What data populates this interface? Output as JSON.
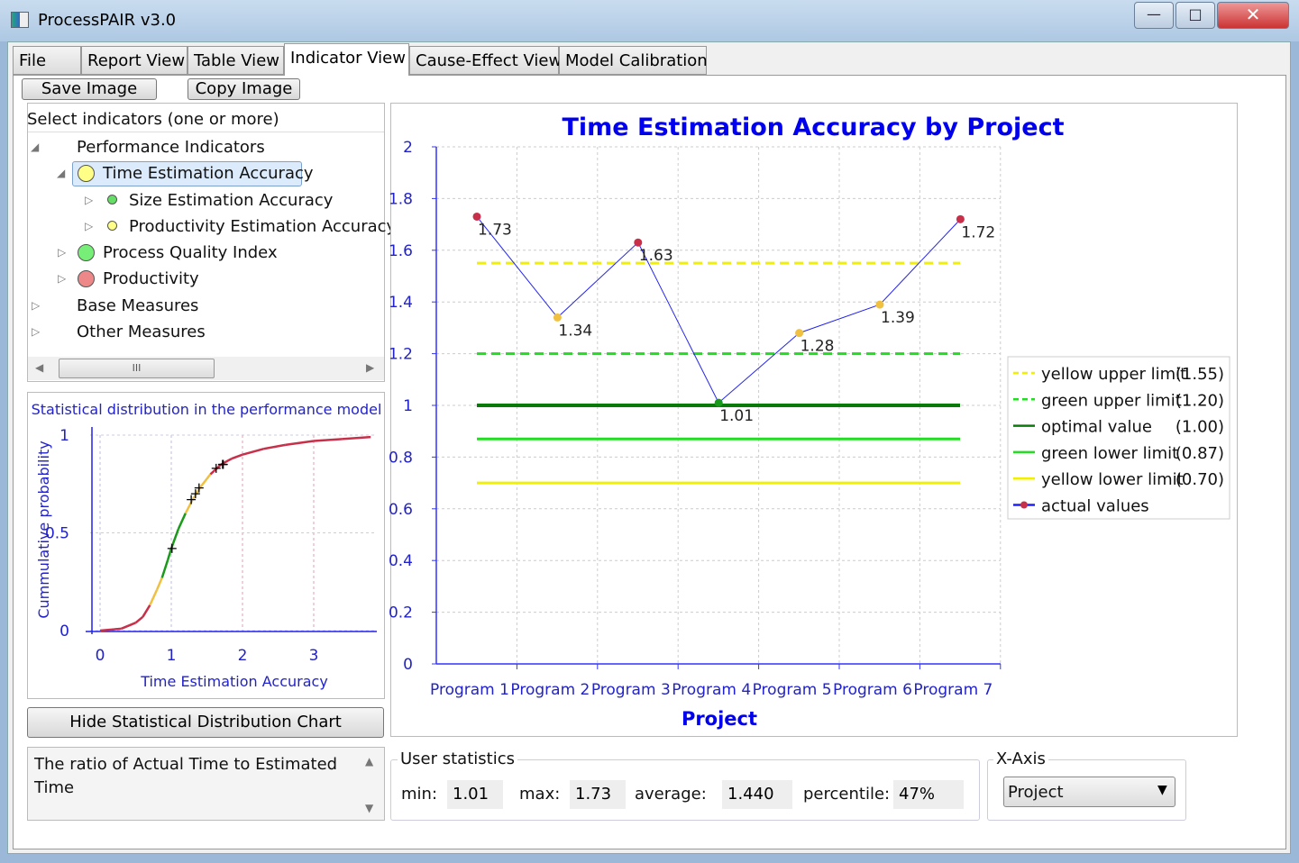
{
  "window": {
    "title": "ProcessPAIR v3.0",
    "minimize": "—",
    "maximize": "□",
    "close": "✕"
  },
  "tabs": [
    {
      "label": "File"
    },
    {
      "label": "Report View"
    },
    {
      "label": "Table View"
    },
    {
      "label": "Indicator View",
      "active": true
    },
    {
      "label": "Cause-Effect View"
    },
    {
      "label": "Model Calibration"
    }
  ],
  "toolbar": {
    "save_label": "Save Image",
    "copy_label": "Copy Image"
  },
  "tree": {
    "header": "Select indicators (one or more)",
    "items": [
      {
        "label": "Performance Indicators",
        "expanded": true
      },
      {
        "label": "Time Estimation Accuracy",
        "status": "yellow",
        "selected": true,
        "expanded": true
      },
      {
        "label": "Size Estimation Accuracy",
        "status": "green"
      },
      {
        "label": "Productivity Estimation Accuracy",
        "status": "yellow"
      },
      {
        "label": "Process Quality Index",
        "status": "green"
      },
      {
        "label": "Productivity",
        "status": "red"
      },
      {
        "label": "Base Measures"
      },
      {
        "label": "Other Measures"
      }
    ],
    "scroll_thumb": "III"
  },
  "hide_dist_label": "Hide Statistical Distribution Chart",
  "description": "The ratio of Actual Time to Estimated Time",
  "stats": {
    "title": "User statistics",
    "min_label": "min:",
    "min": "1.01",
    "max_label": "max:",
    "max": "1.73",
    "avg_label": "average:",
    "avg": "1.440",
    "pct_label": "percentile:",
    "pct": "47%"
  },
  "xaxis": {
    "title": "X-Axis",
    "selected": "Project"
  },
  "colors": {
    "red": "#c8304a",
    "yellow": "#f0c040",
    "green": "#1a9a1a",
    "accent": "#0000ee"
  },
  "chart_data": [
    {
      "type": "line",
      "title": "Time Estimation Accuracy by Project",
      "xlabel": "Project",
      "ylabel": "",
      "categories": [
        "Program 1",
        "Program 2",
        "Program 3",
        "Program 4",
        "Program 5",
        "Program 6",
        "Program 7"
      ],
      "ylim": [
        0,
        2
      ],
      "yticks": [
        "0",
        "0.2",
        "0.4",
        "0.6",
        "0.8",
        "1",
        "1.2",
        "1.4",
        "1.6",
        "1.8",
        "2"
      ],
      "grid": true,
      "legend": "right",
      "series": [
        {
          "name": "actual values",
          "values": [
            1.73,
            1.34,
            1.63,
            1.01,
            1.28,
            1.39,
            1.72
          ],
          "labels": [
            "1.73",
            "1.34",
            "1.63",
            "1.01",
            "1.28",
            "1.39",
            "1.72"
          ],
          "point_status": [
            "red",
            "yellow",
            "red",
            "green",
            "yellow",
            "yellow",
            "red"
          ]
        }
      ],
      "limits": [
        {
          "name": "yellow upper limit",
          "value_label": "(1.55)",
          "value": 1.55,
          "color": "#f0f000",
          "dashed": true
        },
        {
          "name": "green upper limit",
          "value_label": "(1.20)",
          "value": 1.2,
          "color": "#22dd22",
          "dashed": true
        },
        {
          "name": "optimal value",
          "value_label": "(1.00)",
          "value": 1.0,
          "color": "#0a7a0a",
          "dashed": false
        },
        {
          "name": "green lower limit",
          "value_label": "(0.87)",
          "value": 0.87,
          "color": "#22dd22",
          "dashed": false
        },
        {
          "name": "yellow lower limit",
          "value_label": "(0.70)",
          "value": 0.7,
          "color": "#f0f000",
          "dashed": false
        }
      ]
    },
    {
      "type": "line",
      "title": "Statistical distribution in the performance model",
      "xlabel": "Time Estimation Accuracy",
      "ylabel": "Cummulative probability",
      "xlim": [
        0,
        3.8
      ],
      "ylim": [
        0,
        1
      ],
      "xticks": [
        "0",
        "1",
        "2",
        "3"
      ],
      "yticks": [
        "0",
        "0.5",
        "1"
      ],
      "grid": true,
      "curve": [
        [
          0,
          0
        ],
        [
          0.3,
          0.01
        ],
        [
          0.5,
          0.04
        ],
        [
          0.6,
          0.07
        ],
        [
          0.7,
          0.13
        ],
        [
          0.8,
          0.21
        ],
        [
          0.87,
          0.27
        ],
        [
          0.95,
          0.36
        ],
        [
          1.0,
          0.42
        ],
        [
          1.1,
          0.52
        ],
        [
          1.2,
          0.6
        ],
        [
          1.3,
          0.67
        ],
        [
          1.4,
          0.73
        ],
        [
          1.55,
          0.8
        ],
        [
          1.7,
          0.85
        ],
        [
          1.85,
          0.88
        ],
        [
          2.0,
          0.9
        ],
        [
          2.3,
          0.93
        ],
        [
          2.6,
          0.95
        ],
        [
          3.0,
          0.97
        ],
        [
          3.4,
          0.98
        ],
        [
          3.8,
          0.99
        ]
      ],
      "markers": [
        [
          1.01,
          0.42
        ],
        [
          1.28,
          0.67
        ],
        [
          1.34,
          0.7
        ],
        [
          1.39,
          0.73
        ],
        [
          1.63,
          0.83
        ],
        [
          1.72,
          0.85
        ],
        [
          1.73,
          0.85
        ]
      ]
    }
  ]
}
